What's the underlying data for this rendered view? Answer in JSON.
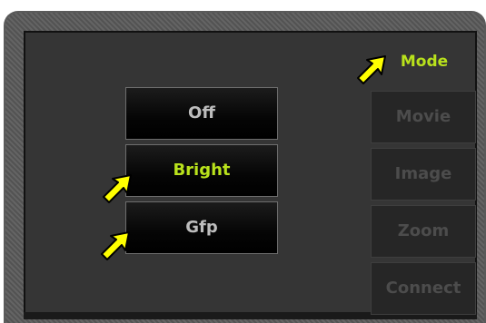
{
  "mode": {
    "label": "Mode",
    "color": "#b9e21c"
  },
  "main_buttons": [
    {
      "label": "Off",
      "selected": false
    },
    {
      "label": "Bright",
      "selected": true
    },
    {
      "label": "Gfp",
      "selected": false
    }
  ],
  "side_buttons": [
    {
      "label": "Movie",
      "enabled": false
    },
    {
      "label": "Image",
      "enabled": false
    },
    {
      "label": "Zoom",
      "enabled": false
    },
    {
      "label": "Connect",
      "enabled": false
    }
  ],
  "annotation_color": "#ffff00",
  "icons": {
    "annotation": "pointer-arrow-icon"
  }
}
